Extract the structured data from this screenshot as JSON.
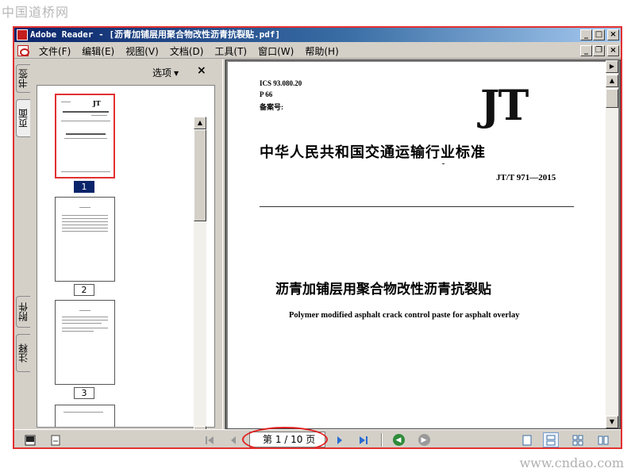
{
  "watermarks": {
    "top_left": "中国道桥网",
    "bottom_right": "www.cndao.com"
  },
  "window": {
    "title": "Adobe Reader - [沥青加铺层用聚合物改性沥青抗裂贴.pdf]",
    "controls": {
      "minimize": "_",
      "maximize": "□",
      "close": "×",
      "restore": "❐"
    }
  },
  "menu": {
    "items": [
      "文件(F)",
      "编辑(E)",
      "视图(V)",
      "文档(D)",
      "工具(T)",
      "窗口(W)",
      "帮助(H)"
    ]
  },
  "nav_panel": {
    "tabs": [
      "书签",
      "页面",
      "附件",
      "注释"
    ],
    "options_label": "选项",
    "close_label": "×",
    "thumbnails": [
      {
        "page": "1",
        "selected": true
      },
      {
        "page": "2",
        "selected": false
      },
      {
        "page": "3",
        "selected": false
      }
    ]
  },
  "document": {
    "ics": "ICS 93.080.20",
    "class": "P 66",
    "record": "备案号:",
    "logo": "JT",
    "standard_title": "中华人民共和国交通运输行业标准",
    "standard_code": "JT/T 971—2015",
    "title_cn": "沥青加铺层用聚合物改性沥青抗裂贴",
    "title_en": "Polymer modified asphalt crack control paste for asphalt overlay"
  },
  "status_bar": {
    "page_indicator": "第 1 / 10 页",
    "highlight_color": "#e02020"
  },
  "icons": {
    "first_page": "first-page-icon",
    "prev_page": "previous-page-icon",
    "next_page": "next-page-icon",
    "last_page": "last-page-icon",
    "back": "back-icon",
    "forward": "forward-icon"
  }
}
